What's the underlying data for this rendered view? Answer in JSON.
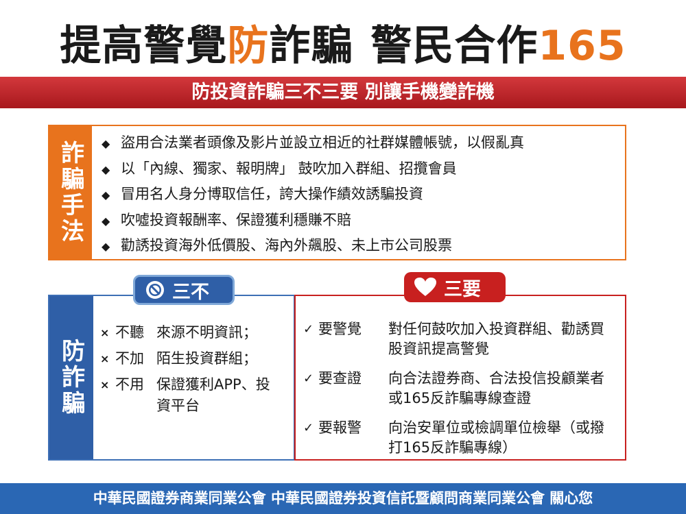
{
  "title": {
    "part1": "提高警覺",
    "highlight": "防",
    "part2": "詐騙",
    "part3": "警民合作",
    "number": "165"
  },
  "banner": "防投資詐騙三不三要  別讓手機變詐機",
  "methods": {
    "label": "詐騙手法",
    "bullet": "◆",
    "items": [
      "盜用合法業者頭像及影片並設立相近的社群媒體帳號，以假亂真",
      "以「內線、獨家、報明牌」 鼓吹加入群組、招攬會員",
      "冒用名人身分博取信任，誇大操作績效誘騙投資",
      "吹噓投資報酬率、保證獲利穩賺不賠",
      "勸誘投資海外低價股、海內外飆股、未上市公司股票"
    ]
  },
  "prevent": {
    "label": "防詐騙",
    "three_no": {
      "title": "三不",
      "icon": "prohibited-icon",
      "mark": "×",
      "items": [
        {
          "verb": "不聽",
          "text": "來源不明資訊；"
        },
        {
          "verb": "不加",
          "text": "陌生投資群組；"
        },
        {
          "verb": "不用",
          "text": "保證獲利APP、投資平台"
        }
      ]
    },
    "three_yes": {
      "title": "三要",
      "icon": "heart-icon",
      "mark": "✓",
      "items": [
        {
          "verb": "要警覺",
          "text": "對任何鼓吹加入投資群組、勸誘買股資訊提高警覺"
        },
        {
          "verb": "要查證",
          "text": "向合法證券商、合法投信投顧業者或165反詐騙專線查證"
        },
        {
          "verb": "要報警",
          "text": "向治安單位或檢調單位檢舉（或撥打165反詐騙專線）"
        }
      ]
    }
  },
  "footer": "中華民國證券商業同業公會  中華民國證券投資信託暨顧問商業同業公會  關心您",
  "colors": {
    "orange": "#e8731d",
    "red": "#c8201f",
    "blue": "#2f5fa7",
    "footer_blue": "#2a67b4"
  }
}
